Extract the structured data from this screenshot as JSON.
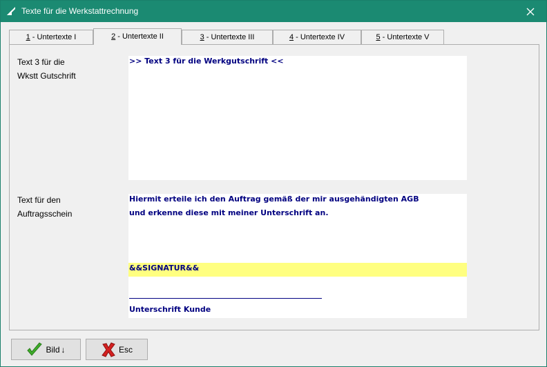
{
  "window": {
    "title": "Texte für die Werkstattrechnung",
    "close_glyph": "✕",
    "accent": "#1b8a72"
  },
  "tabs": [
    {
      "key": "1",
      "label": " - Untertexte I"
    },
    {
      "key": "2",
      "label": " - Untertexte II"
    },
    {
      "key": "3",
      "label": " - Untertexte III"
    },
    {
      "key": "4",
      "label": " - Untertexte IV"
    },
    {
      "key": "5",
      "label": " - Untertexte V"
    }
  ],
  "active_tab": 1,
  "fields": {
    "gutschrift": {
      "label_line1": "Text 3 für die",
      "label_line2": "Wkstt Gutschrift",
      "lines": [
        ">> Text 3 für die Werkgutschrift <<"
      ]
    },
    "auftrag": {
      "label_line1": "Text für den",
      "label_line2": "Auftragsschein",
      "line1": "Hiermit erteile ich den Auftrag gemäß der mir ausgehändigten AGB",
      "line2": "und erkenne diese mit meiner Unterschrift an.",
      "signature_placeholder": "&&SIGNATUR&&",
      "signature_caption": "Unterschrift Kunde",
      "highlight_color": "#ffff80"
    }
  },
  "buttons": {
    "bild": {
      "label": "Bild",
      "arrow": "↓",
      "icon": "checkmark-icon"
    },
    "esc": {
      "label": "Esc",
      "icon": "red-x-icon"
    }
  }
}
